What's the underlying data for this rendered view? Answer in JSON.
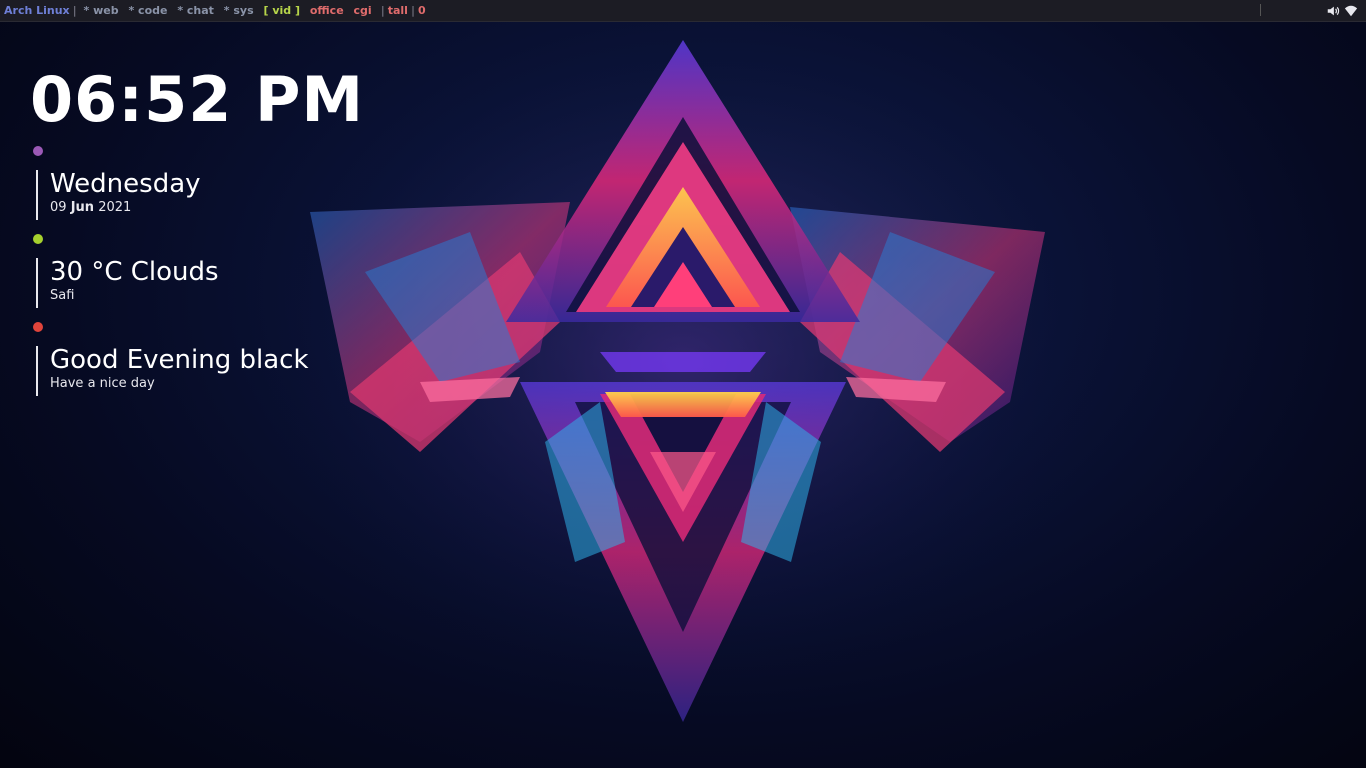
{
  "topbar": {
    "os_label": "Arch Linux",
    "workspaces": [
      {
        "label": "* web"
      },
      {
        "label": "* code"
      },
      {
        "label": "* chat"
      },
      {
        "label": "* sys"
      },
      {
        "label": "[ vid ]"
      },
      {
        "label": "office"
      },
      {
        "label": "cgi"
      }
    ],
    "layout": "tall",
    "window_count": "0",
    "tray": {
      "volume_icon": "speaker-icon",
      "network_icon": "wifi-icon"
    }
  },
  "widgets": {
    "clock": "06:52 PM",
    "date": {
      "day": "Wednesday",
      "day_num": "09",
      "month": "Jun",
      "year": "2021",
      "dot_color": "#9b59b6"
    },
    "weather": {
      "summary": "30 °C Clouds",
      "location": "Safi",
      "dot_color": "#a6d12e"
    },
    "greeting": {
      "title": "Good Evening black",
      "subtitle": "Have a nice day",
      "dot_color": "#e0443b"
    }
  },
  "colors": {
    "os_label": "#6e7fd6",
    "workspace_inactive": "#8a93a8",
    "workspace_current": "#b7d54a",
    "workspace_hidden": "#e06c6c",
    "background": "#060a22"
  }
}
